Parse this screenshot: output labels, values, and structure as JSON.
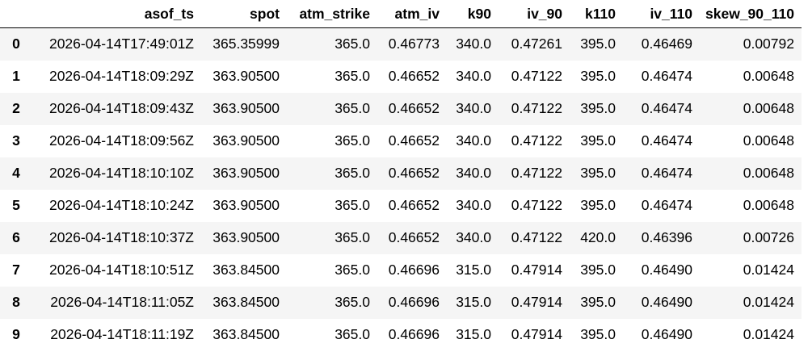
{
  "table": {
    "columns": [
      "",
      "asof_ts",
      "spot",
      "atm_strike",
      "atm_iv",
      "k90",
      "iv_90",
      "k110",
      "iv_110",
      "skew_90_110"
    ],
    "rows": [
      {
        "index": "0",
        "cells": [
          "2026-04-14T17:49:01Z",
          "365.35999",
          "365.0",
          "0.46773",
          "340.0",
          "0.47261",
          "395.0",
          "0.46469",
          "0.00792"
        ]
      },
      {
        "index": "1",
        "cells": [
          "2026-04-14T18:09:29Z",
          "363.90500",
          "365.0",
          "0.46652",
          "340.0",
          "0.47122",
          "395.0",
          "0.46474",
          "0.00648"
        ]
      },
      {
        "index": "2",
        "cells": [
          "2026-04-14T18:09:43Z",
          "363.90500",
          "365.0",
          "0.46652",
          "340.0",
          "0.47122",
          "395.0",
          "0.46474",
          "0.00648"
        ]
      },
      {
        "index": "3",
        "cells": [
          "2026-04-14T18:09:56Z",
          "363.90500",
          "365.0",
          "0.46652",
          "340.0",
          "0.47122",
          "395.0",
          "0.46474",
          "0.00648"
        ]
      },
      {
        "index": "4",
        "cells": [
          "2026-04-14T18:10:10Z",
          "363.90500",
          "365.0",
          "0.46652",
          "340.0",
          "0.47122",
          "395.0",
          "0.46474",
          "0.00648"
        ]
      },
      {
        "index": "5",
        "cells": [
          "2026-04-14T18:10:24Z",
          "363.90500",
          "365.0",
          "0.46652",
          "340.0",
          "0.47122",
          "395.0",
          "0.46474",
          "0.00648"
        ]
      },
      {
        "index": "6",
        "cells": [
          "2026-04-14T18:10:37Z",
          "363.90500",
          "365.0",
          "0.46652",
          "340.0",
          "0.47122",
          "420.0",
          "0.46396",
          "0.00726"
        ]
      },
      {
        "index": "7",
        "cells": [
          "2026-04-14T18:10:51Z",
          "363.84500",
          "365.0",
          "0.46696",
          "315.0",
          "0.47914",
          "395.0",
          "0.46490",
          "0.01424"
        ]
      },
      {
        "index": "8",
        "cells": [
          "2026-04-14T18:11:05Z",
          "363.84500",
          "365.0",
          "0.46696",
          "315.0",
          "0.47914",
          "395.0",
          "0.46490",
          "0.01424"
        ]
      },
      {
        "index": "9",
        "cells": [
          "2026-04-14T18:11:19Z",
          "363.84500",
          "365.0",
          "0.46696",
          "315.0",
          "0.47914",
          "395.0",
          "0.46490",
          "0.01424"
        ]
      }
    ]
  }
}
